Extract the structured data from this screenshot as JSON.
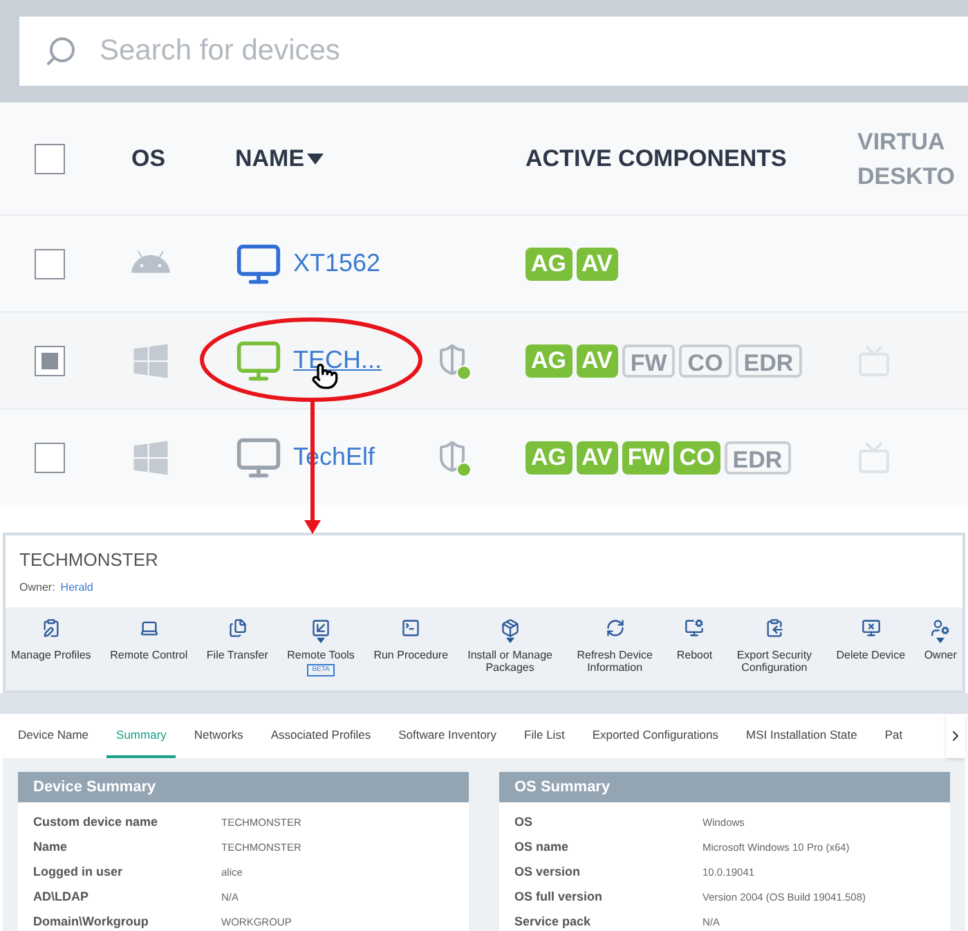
{
  "search": {
    "placeholder": "Search for devices"
  },
  "table": {
    "select_all_checked": false,
    "columns": [
      {
        "label": "OS",
        "sorted": false
      },
      {
        "label": "NAME",
        "sorted": true
      },
      {
        "label": "ACTIVE COMPONENTS",
        "sorted": false
      },
      {
        "label": "VIRTUA DESKTO"
      }
    ],
    "rows": [
      {
        "checked": false,
        "kind": "android",
        "name": "XT1562",
        "link_hover": false,
        "color": "#2f6fd6",
        "shield": false,
        "components": [
          {
            "label": "AG",
            "on": true
          },
          {
            "label": "AV",
            "on": true
          }
        ],
        "vd": false
      },
      {
        "checked": true,
        "kind": "windows",
        "name": "TECH...",
        "link_hover": true,
        "color": "#7bbf3a",
        "shield": true,
        "components": [
          {
            "label": "AG",
            "on": true
          },
          {
            "label": "AV",
            "on": true
          },
          {
            "label": "FW",
            "on": false
          },
          {
            "label": "CO",
            "on": false
          },
          {
            "label": "EDR",
            "on": false
          }
        ],
        "vd": true
      },
      {
        "checked": false,
        "kind": "windows",
        "name": "TechElf",
        "link_hover": false,
        "color": "#9aa3ad",
        "shield": true,
        "components": [
          {
            "label": "AG",
            "on": true
          },
          {
            "label": "AV",
            "on": true
          },
          {
            "label": "FW",
            "on": true
          },
          {
            "label": "CO",
            "on": true
          },
          {
            "label": "EDR",
            "on": false
          }
        ],
        "vd": true
      }
    ]
  },
  "detail": {
    "title": "TECHMONSTER",
    "owner_label": "Owner:",
    "owner": "Herald",
    "toolbar": [
      {
        "label": "Manage Profiles",
        "dropdown": false
      },
      {
        "label": "Remote Control",
        "dropdown": false
      },
      {
        "label": "File Transfer",
        "dropdown": false
      },
      {
        "label": "Remote Tools",
        "dropdown": true,
        "badge": "BETA"
      },
      {
        "label": "Run Procedure",
        "dropdown": false
      },
      {
        "label": "Install or Manage Packages",
        "dropdown": true
      },
      {
        "label": "Refresh Device Information",
        "dropdown": false
      },
      {
        "label": "Reboot",
        "dropdown": false
      },
      {
        "label": "Export Security Configuration",
        "dropdown": false
      },
      {
        "label": "Delete Device",
        "dropdown": false
      },
      {
        "label": "Owner",
        "dropdown": true
      }
    ],
    "tabs": [
      {
        "label": "Device Name",
        "selected": false
      },
      {
        "label": "Summary",
        "selected": true
      },
      {
        "label": "Networks",
        "selected": false
      },
      {
        "label": "Associated Profiles",
        "selected": false
      },
      {
        "label": "Software Inventory",
        "selected": false
      },
      {
        "label": "File List",
        "selected": false
      },
      {
        "label": "Exported Configurations",
        "selected": false
      },
      {
        "label": "MSI Installation State",
        "selected": false
      },
      {
        "label": "Pat",
        "selected": false
      }
    ],
    "cards": [
      {
        "title": "Device Summary",
        "fields": [
          {
            "label": "Custom device name",
            "value": "TECHMONSTER"
          },
          {
            "label": "Name",
            "value": "TECHMONSTER"
          },
          {
            "label": "Logged in user",
            "value": "alice"
          },
          {
            "label": "AD\\LDAP",
            "value": "N/A"
          },
          {
            "label": "Domain\\Workgroup",
            "value": "WORKGROUP"
          }
        ]
      },
      {
        "title": "OS Summary",
        "fields": [
          {
            "label": "OS",
            "value": "Windows"
          },
          {
            "label": "OS name",
            "value": "Microsoft Windows 10 Pro (x64)"
          },
          {
            "label": "OS version",
            "value": "10.0.19041"
          },
          {
            "label": "OS full version",
            "value": "Version 2004 (OS Build 19041.508)"
          },
          {
            "label": "Service pack",
            "value": "N/A"
          }
        ]
      }
    ]
  }
}
